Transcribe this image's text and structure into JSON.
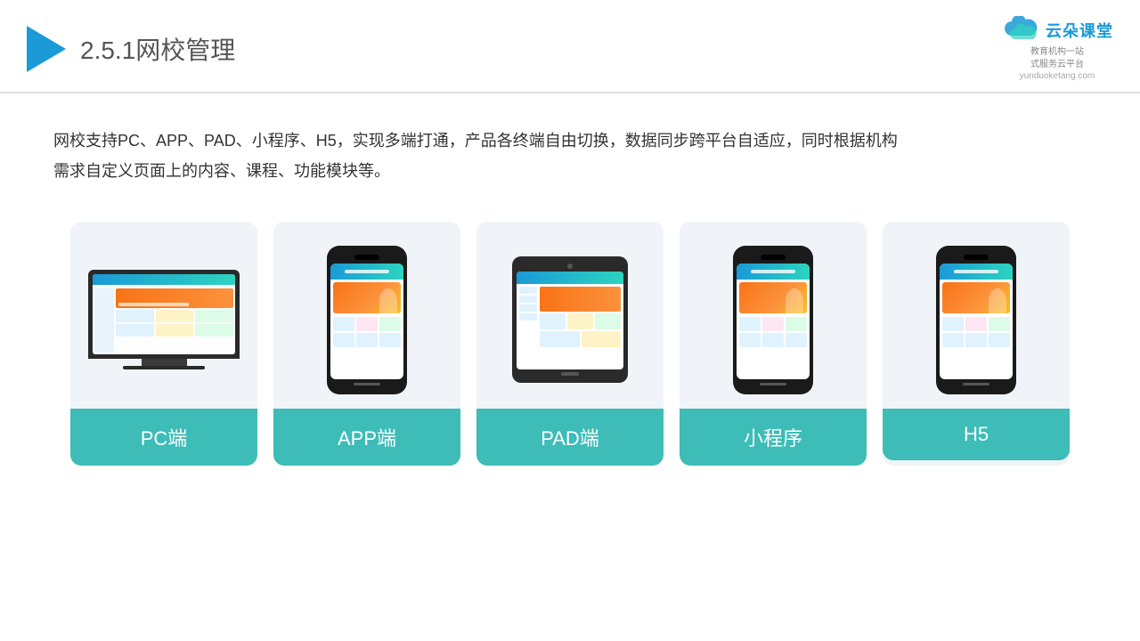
{
  "header": {
    "title_num": "2.5.1",
    "title_cn": "网校管理",
    "logo_cn": "云朵课堂",
    "logo_domain": "yunduoketang.com",
    "logo_sub_line1": "教育机构一站",
    "logo_sub_line2": "式服务云平台"
  },
  "description": {
    "text_line1": "网校支持PC、APP、PAD、小程序、H5，实现多端打通，产品各终端自由切换，数据同步跨平台自适应，同时根据机构",
    "text_line2": "需求自定义页面上的内容、课程、功能模块等。"
  },
  "cards": [
    {
      "label": "PC端",
      "type": "pc"
    },
    {
      "label": "APP端",
      "type": "phone"
    },
    {
      "label": "PAD端",
      "type": "tablet"
    },
    {
      "label": "小程序",
      "type": "phone"
    },
    {
      "label": "H5",
      "type": "phone"
    }
  ]
}
